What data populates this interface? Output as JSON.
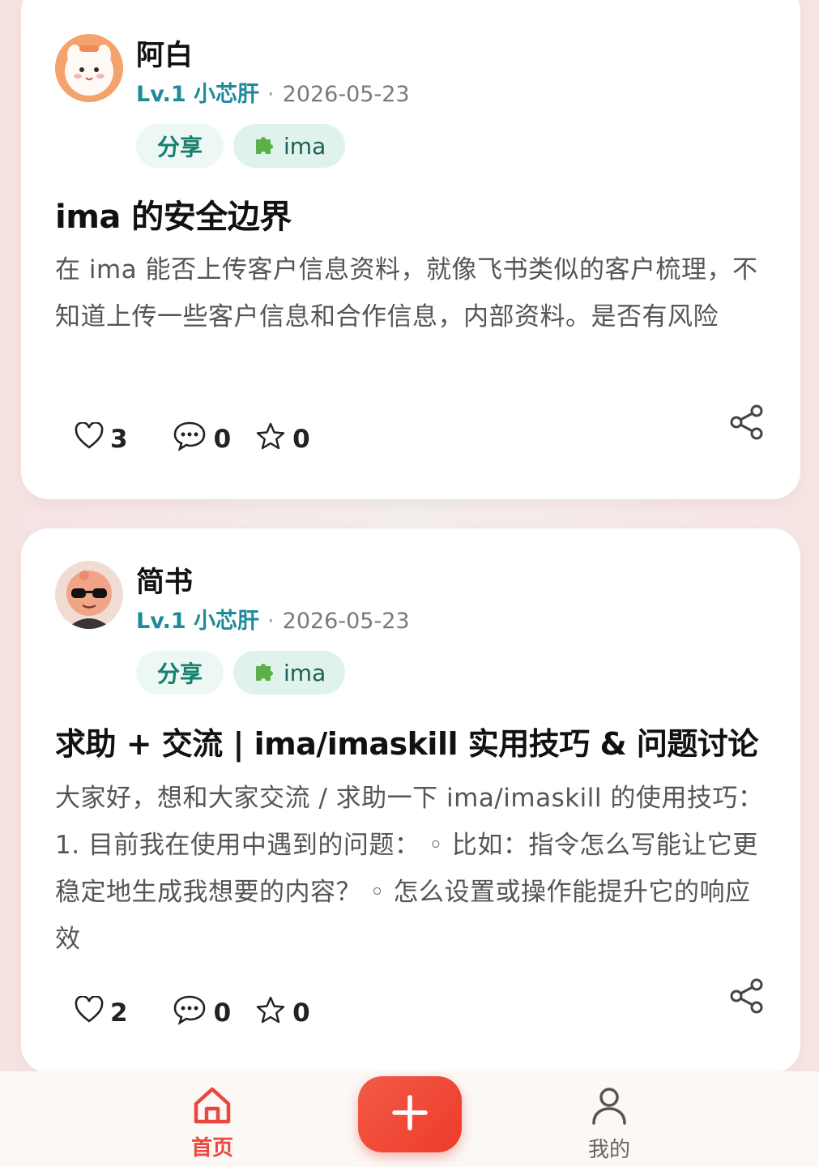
{
  "posts": [
    {
      "author": "阿白",
      "level": "Lv.1 小芯肝",
      "separator": "·",
      "date": "2026-05-23",
      "tags": [
        "分享",
        "ima"
      ],
      "title": "ima 的安全边界",
      "body": "在 ima 能否上传客户信息资料，就像飞书类似的客户梳理，不知道上传一些客户信息和合作信息，内部资料。是否有风险",
      "likes": "3",
      "comments": "0",
      "favorites": "0"
    },
    {
      "author": "简书",
      "level": "Lv.1 小芯肝",
      "separator": "·",
      "date": "2026-05-23",
      "tags": [
        "分享",
        "ima"
      ],
      "title": "求助 + 交流 | ima/imaskill 实用技巧 & 问题讨论",
      "body": "大家好，想和大家交流 / 求助一下 ima/imaskill 的使用技巧： 1. 目前我在使用中遇到的问题： ◦ 比如：指令怎么写能让它更稳定地生成我想要的内容？ ◦ 怎么设置或操作能提升它的响应效",
      "likes": "2",
      "comments": "0",
      "favorites": "0"
    }
  ],
  "tabbar": {
    "home_label": "首页",
    "me_label": "我的",
    "add_icon": "plus-icon"
  },
  "colors": {
    "accent": "#e8483d",
    "level_text": "#1e8a9a",
    "tag_text": "#16806c"
  }
}
